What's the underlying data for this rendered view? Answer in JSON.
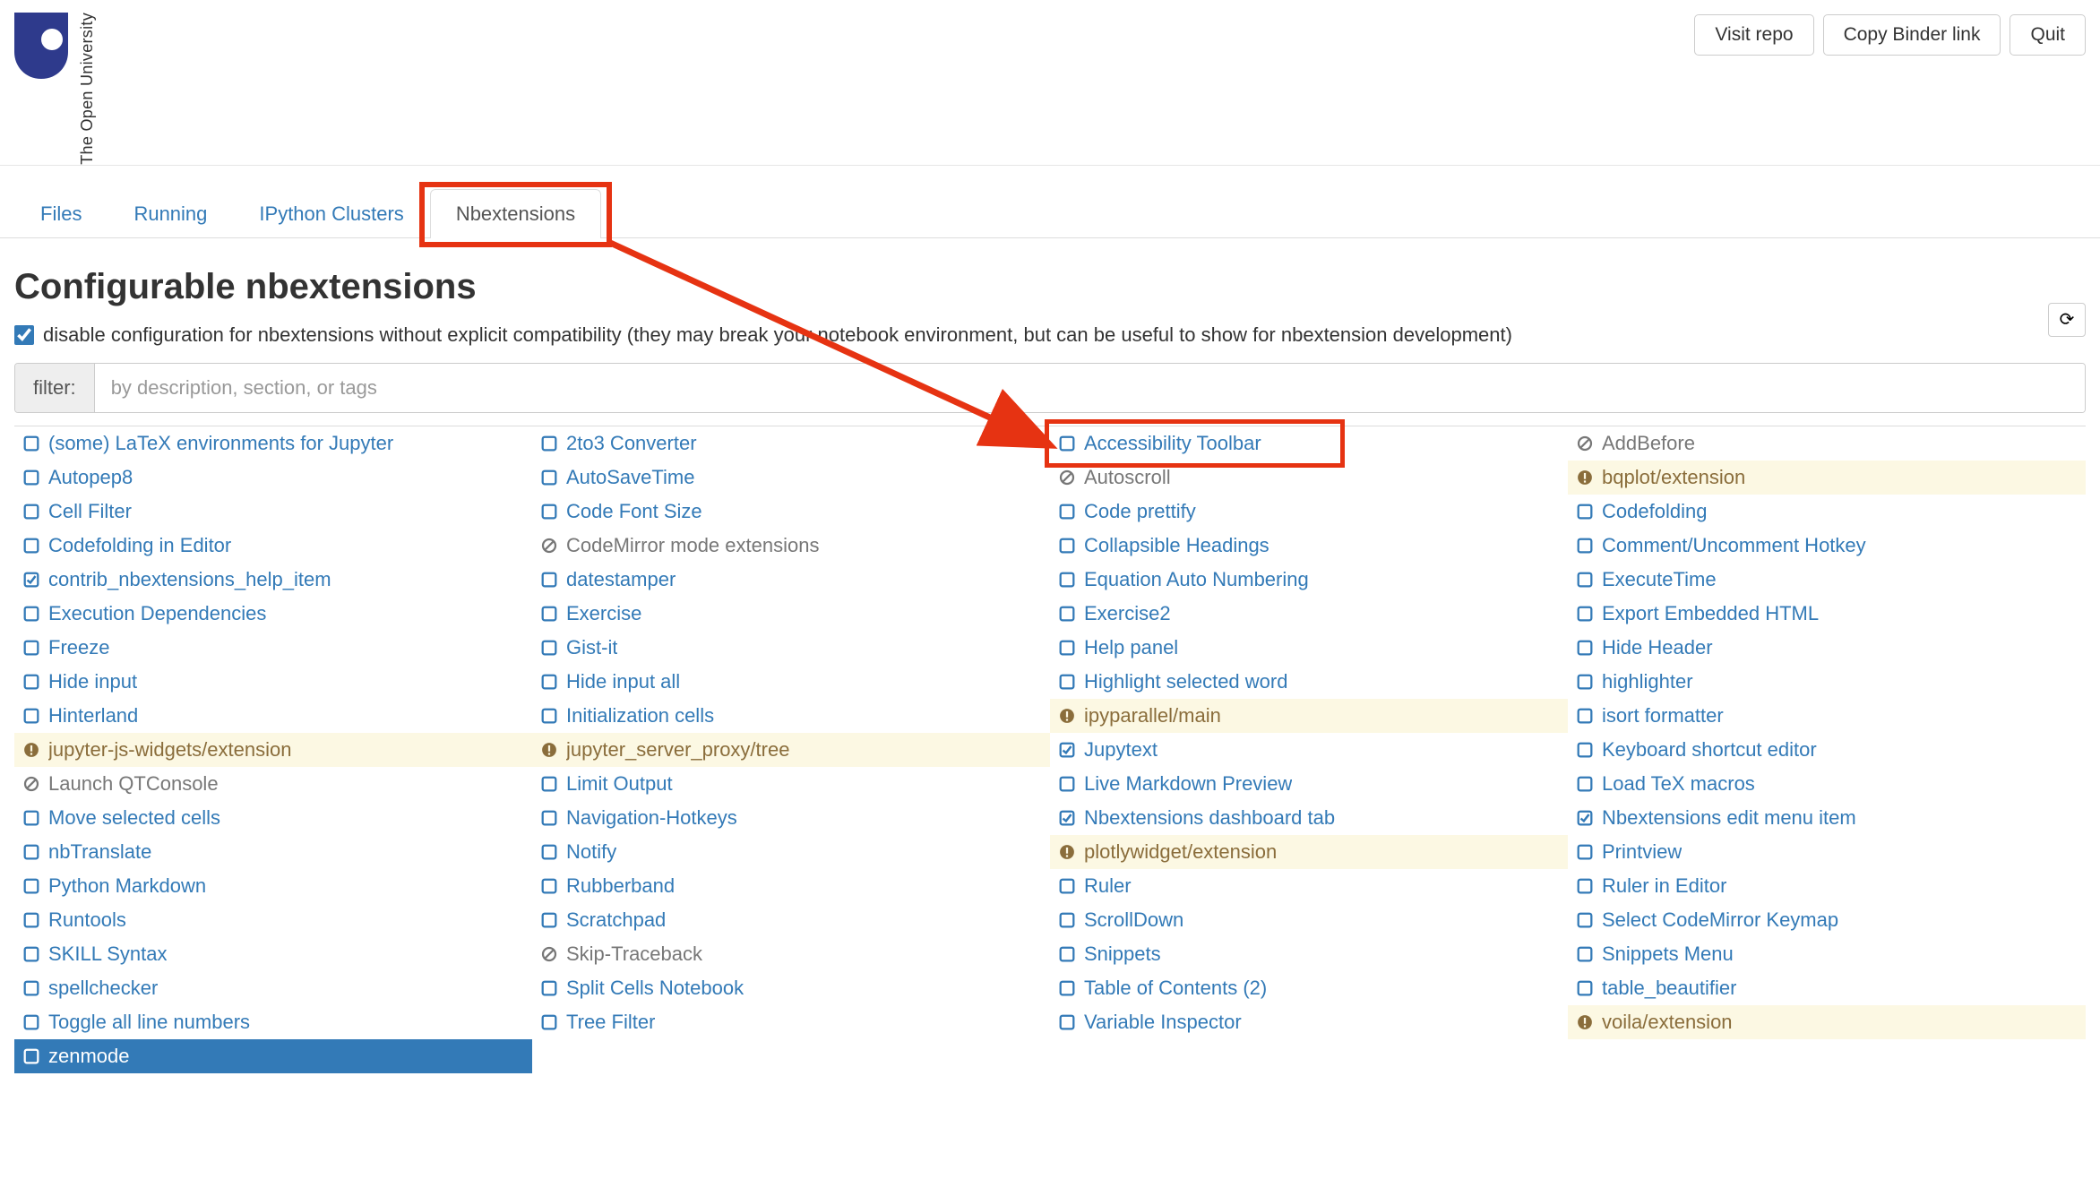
{
  "header": {
    "logo_text": "The Open University",
    "buttons": {
      "visit_repo": "Visit repo",
      "copy_binder": "Copy Binder link",
      "quit": "Quit"
    }
  },
  "tabs": {
    "items": [
      "Files",
      "Running",
      "IPython Clusters",
      "Nbextensions"
    ],
    "active_index": 3
  },
  "page": {
    "title": "Configurable nbextensions",
    "compat_checked": true,
    "compat_label": "disable configuration for nbextensions without explicit compatibility (they may break your notebook environment, but can be useful to show for nbextension development)",
    "filter_label": "filter:",
    "filter_placeholder": "by description, section, or tags"
  },
  "annotation": {
    "tab_highlight_target": "Nbextensions",
    "cell_highlight_target": "Accessibility Toolbar"
  },
  "extensions": [
    {
      "label": "(some) LaTeX environments for Jupyter",
      "state": "unchecked"
    },
    {
      "label": "2to3 Converter",
      "state": "unchecked"
    },
    {
      "label": "Accessibility Toolbar",
      "state": "unchecked"
    },
    {
      "label": "AddBefore",
      "state": "disabled"
    },
    {
      "label": "Autopep8",
      "state": "unchecked"
    },
    {
      "label": "AutoSaveTime",
      "state": "unchecked"
    },
    {
      "label": "Autoscroll",
      "state": "disabled"
    },
    {
      "label": "bqplot/extension",
      "state": "warn"
    },
    {
      "label": "Cell Filter",
      "state": "unchecked"
    },
    {
      "label": "Code Font Size",
      "state": "unchecked"
    },
    {
      "label": "Code prettify",
      "state": "unchecked"
    },
    {
      "label": "Codefolding",
      "state": "unchecked"
    },
    {
      "label": "Codefolding in Editor",
      "state": "unchecked"
    },
    {
      "label": "CodeMirror mode extensions",
      "state": "disabled"
    },
    {
      "label": "Collapsible Headings",
      "state": "unchecked"
    },
    {
      "label": "Comment/Uncomment Hotkey",
      "state": "unchecked"
    },
    {
      "label": "contrib_nbextensions_help_item",
      "state": "checked"
    },
    {
      "label": "datestamper",
      "state": "unchecked"
    },
    {
      "label": "Equation Auto Numbering",
      "state": "unchecked"
    },
    {
      "label": "ExecuteTime",
      "state": "unchecked"
    },
    {
      "label": "Execution Dependencies",
      "state": "unchecked"
    },
    {
      "label": "Exercise",
      "state": "unchecked"
    },
    {
      "label": "Exercise2",
      "state": "unchecked"
    },
    {
      "label": "Export Embedded HTML",
      "state": "unchecked"
    },
    {
      "label": "Freeze",
      "state": "unchecked"
    },
    {
      "label": "Gist-it",
      "state": "unchecked"
    },
    {
      "label": "Help panel",
      "state": "unchecked"
    },
    {
      "label": "Hide Header",
      "state": "unchecked"
    },
    {
      "label": "Hide input",
      "state": "unchecked"
    },
    {
      "label": "Hide input all",
      "state": "unchecked"
    },
    {
      "label": "Highlight selected word",
      "state": "unchecked"
    },
    {
      "label": "highlighter",
      "state": "unchecked"
    },
    {
      "label": "Hinterland",
      "state": "unchecked"
    },
    {
      "label": "Initialization cells",
      "state": "unchecked"
    },
    {
      "label": "ipyparallel/main",
      "state": "warn"
    },
    {
      "label": "isort formatter",
      "state": "unchecked"
    },
    {
      "label": "jupyter-js-widgets/extension",
      "state": "warn"
    },
    {
      "label": "jupyter_server_proxy/tree",
      "state": "warn"
    },
    {
      "label": "Jupytext",
      "state": "checked"
    },
    {
      "label": "Keyboard shortcut editor",
      "state": "unchecked"
    },
    {
      "label": "Launch QTConsole",
      "state": "disabled"
    },
    {
      "label": "Limit Output",
      "state": "unchecked"
    },
    {
      "label": "Live Markdown Preview",
      "state": "unchecked"
    },
    {
      "label": "Load TeX macros",
      "state": "unchecked"
    },
    {
      "label": "Move selected cells",
      "state": "unchecked"
    },
    {
      "label": "Navigation-Hotkeys",
      "state": "unchecked"
    },
    {
      "label": "Nbextensions dashboard tab",
      "state": "checked"
    },
    {
      "label": "Nbextensions edit menu item",
      "state": "checked"
    },
    {
      "label": "nbTranslate",
      "state": "unchecked"
    },
    {
      "label": "Notify",
      "state": "unchecked"
    },
    {
      "label": "plotlywidget/extension",
      "state": "warn"
    },
    {
      "label": "Printview",
      "state": "unchecked"
    },
    {
      "label": "Python Markdown",
      "state": "unchecked"
    },
    {
      "label": "Rubberband",
      "state": "unchecked"
    },
    {
      "label": "Ruler",
      "state": "unchecked"
    },
    {
      "label": "Ruler in Editor",
      "state": "unchecked"
    },
    {
      "label": "Runtools",
      "state": "unchecked"
    },
    {
      "label": "Scratchpad",
      "state": "unchecked"
    },
    {
      "label": "ScrollDown",
      "state": "unchecked"
    },
    {
      "label": "Select CodeMirror Keymap",
      "state": "unchecked"
    },
    {
      "label": "SKILL Syntax",
      "state": "unchecked"
    },
    {
      "label": "Skip-Traceback",
      "state": "disabled"
    },
    {
      "label": "Snippets",
      "state": "unchecked"
    },
    {
      "label": "Snippets Menu",
      "state": "unchecked"
    },
    {
      "label": "spellchecker",
      "state": "unchecked"
    },
    {
      "label": "Split Cells Notebook",
      "state": "unchecked"
    },
    {
      "label": "Table of Contents (2)",
      "state": "unchecked"
    },
    {
      "label": "table_beautifier",
      "state": "unchecked"
    },
    {
      "label": "Toggle all line numbers",
      "state": "unchecked"
    },
    {
      "label": "Tree Filter",
      "state": "unchecked"
    },
    {
      "label": "Variable Inspector",
      "state": "unchecked"
    },
    {
      "label": "voila/extension",
      "state": "warn"
    },
    {
      "label": "zenmode",
      "state": "selected"
    }
  ]
}
